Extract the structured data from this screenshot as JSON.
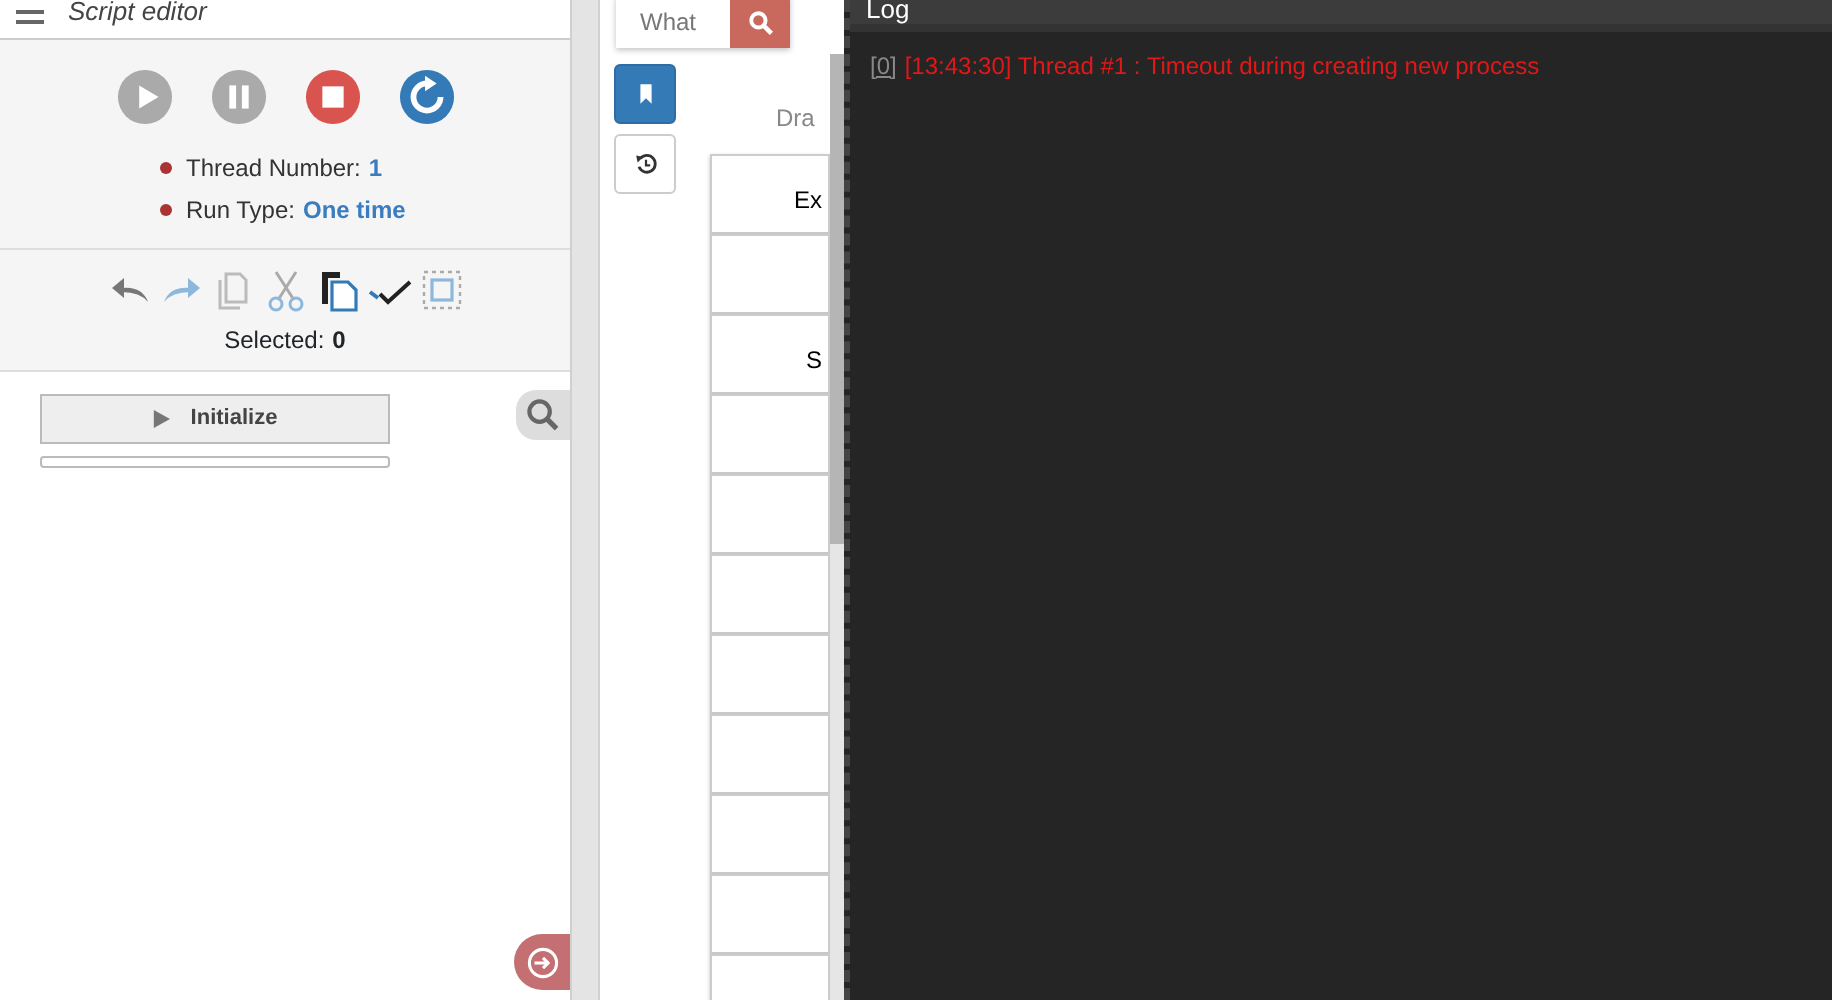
{
  "sidebar": {
    "title": "Script editor",
    "controls": [
      {
        "kind": "play",
        "disabled": true
      },
      {
        "kind": "pause",
        "disabled": true
      },
      {
        "kind": "stop",
        "disabled": false
      },
      {
        "kind": "restart",
        "disabled": false
      }
    ],
    "info": [
      {
        "label": "Thread Number:",
        "value": "1"
      },
      {
        "label": "Run Type:",
        "value": "One time"
      }
    ],
    "tools": [
      {
        "kind": "undo",
        "disabled": false
      },
      {
        "kind": "redo",
        "disabled": true
      },
      {
        "kind": "copy",
        "disabled": true
      },
      {
        "kind": "cut",
        "disabled": true
      },
      {
        "kind": "paste",
        "disabled": false
      },
      {
        "kind": "check",
        "disabled": false
      },
      {
        "kind": "select",
        "disabled": true
      }
    ],
    "selected_label": "Selected:",
    "selected_value": "0",
    "steps": [
      {
        "label": "Initialize",
        "level": 0
      }
    ]
  },
  "middle": {
    "search": {
      "placeholder": "What"
    },
    "tool_buttons": [
      {
        "kind": "bookmark",
        "selected": true
      },
      {
        "kind": "history",
        "selected": false
      }
    ],
    "heading": "Dra",
    "cards": [
      {
        "kind": "text",
        "label": "Ex"
      },
      {
        "kind": "blank"
      },
      {
        "kind": "text",
        "label": "S"
      },
      {
        "kind": "blank"
      },
      {
        "kind": "blank"
      },
      {
        "kind": "blank"
      },
      {
        "kind": "blank"
      },
      {
        "kind": "blank"
      },
      {
        "kind": "blank"
      },
      {
        "kind": "blank"
      },
      {
        "kind": "blank"
      }
    ]
  },
  "log": {
    "title": "Log",
    "entries": [
      {
        "index": "[0]",
        "text": "[13:43:30] Thread #1 : Timeout during creating new process",
        "kind": "error"
      }
    ]
  }
}
